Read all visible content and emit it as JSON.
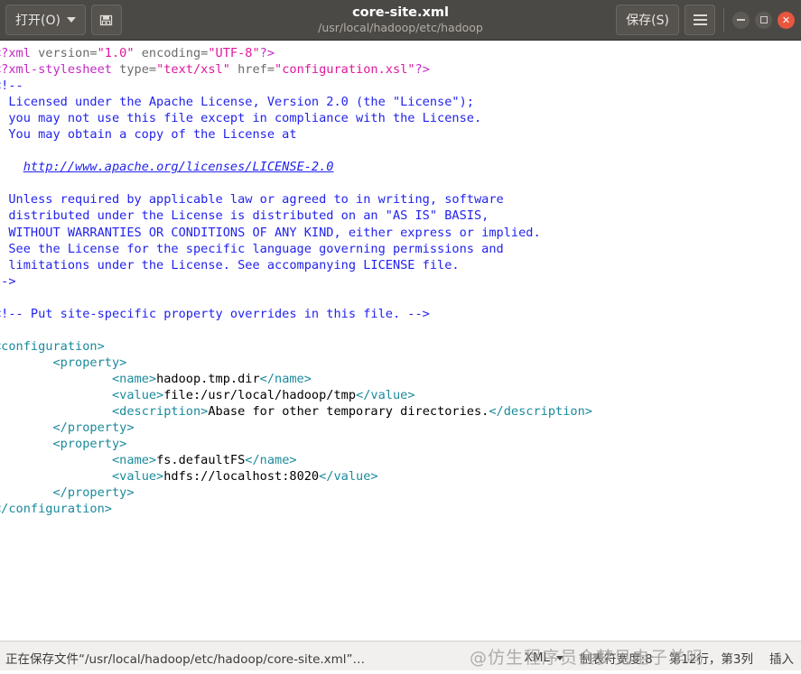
{
  "titlebar": {
    "open_button": "打开(O)",
    "saveas_icon": "save-as-disk-icon",
    "dropdown_icon": "chevron-down-icon",
    "title": "core-site.xml",
    "subtitle": "/usr/local/hadoop/etc/hadoop",
    "save_button": "保存(S)",
    "menu_icon": "hamburger-menu-icon",
    "window_minimize": "−",
    "window_maximize": "□",
    "window_close": "✕",
    "accent_close_color": "#e8563f",
    "bar_color": "#4b4945"
  },
  "editor": {
    "lines": [
      {
        "id": "l1",
        "segments": [
          {
            "cls": "pi",
            "t": "<?xml "
          },
          {
            "cls": "attr",
            "t": "version="
          },
          {
            "cls": "val",
            "t": "\"1.0\""
          },
          {
            "cls": "attr",
            "t": " encoding="
          },
          {
            "cls": "val",
            "t": "\"UTF-8\""
          },
          {
            "cls": "pi",
            "t": "?>"
          }
        ]
      },
      {
        "id": "l2",
        "segments": [
          {
            "cls": "pi",
            "t": "<?xml-stylesheet "
          },
          {
            "cls": "attr",
            "t": "type="
          },
          {
            "cls": "val",
            "t": "\"text/xsl\""
          },
          {
            "cls": "attr",
            "t": " href="
          },
          {
            "cls": "val",
            "t": "\"configuration.xsl\""
          },
          {
            "cls": "pi",
            "t": "?>"
          }
        ]
      },
      {
        "id": "l3",
        "segments": [
          {
            "cls": "cmt",
            "t": "<!--"
          }
        ]
      },
      {
        "id": "l4",
        "segments": [
          {
            "cls": "cmt",
            "t": "  Licensed under the Apache License, Version 2.0 (the \"License\");"
          }
        ]
      },
      {
        "id": "l5",
        "segments": [
          {
            "cls": "cmt",
            "t": "  you may not use this file except in compliance with the License."
          }
        ]
      },
      {
        "id": "l6",
        "segments": [
          {
            "cls": "cmt",
            "t": "  You may obtain a copy of the License at"
          }
        ]
      },
      {
        "id": "l7",
        "segments": [
          {
            "cls": "cmt",
            "t": ""
          }
        ]
      },
      {
        "id": "l8",
        "segments": [
          {
            "cls": "cmt",
            "t": "    "
          },
          {
            "cls": "lnk",
            "t": "http://www.apache.org/licenses/LICENSE-2.0"
          }
        ]
      },
      {
        "id": "l9",
        "segments": [
          {
            "cls": "cmt",
            "t": ""
          }
        ]
      },
      {
        "id": "l10",
        "segments": [
          {
            "cls": "cmt",
            "t": "  Unless required by applicable law or agreed to in writing, software"
          }
        ]
      },
      {
        "id": "l11",
        "segments": [
          {
            "cls": "cmt",
            "t": "  distributed under the License is distributed on an \"AS IS\" BASIS,"
          }
        ]
      },
      {
        "id": "l12",
        "segments": [
          {
            "cls": "cmt",
            "t": "  WITHOUT WARRANTIES OR CONDITIONS OF ANY KIND, either express or implied."
          }
        ]
      },
      {
        "id": "l13",
        "segments": [
          {
            "cls": "cmt",
            "t": "  See the License for the specific language governing permissions and"
          }
        ]
      },
      {
        "id": "l14",
        "segments": [
          {
            "cls": "cmt",
            "t": "  limitations under the License. See accompanying LICENSE file."
          }
        ]
      },
      {
        "id": "l15",
        "segments": [
          {
            "cls": "cmt",
            "t": "-->"
          }
        ]
      },
      {
        "id": "l16",
        "segments": [
          {
            "cls": "txt",
            "t": ""
          }
        ]
      },
      {
        "id": "l17",
        "segments": [
          {
            "cls": "cmt",
            "t": "<!-- Put site-specific property overrides in this file. -->"
          }
        ]
      },
      {
        "id": "l18",
        "segments": [
          {
            "cls": "txt",
            "t": ""
          }
        ]
      },
      {
        "id": "l19",
        "segments": [
          {
            "cls": "tag",
            "t": "<configuration>"
          }
        ]
      },
      {
        "id": "l20",
        "segments": [
          {
            "cls": "txt",
            "t": "        "
          },
          {
            "cls": "tag",
            "t": "<property>"
          }
        ]
      },
      {
        "id": "l21",
        "segments": [
          {
            "cls": "txt",
            "t": "                "
          },
          {
            "cls": "tag",
            "t": "<name>"
          },
          {
            "cls": "txt",
            "t": "hadoop.tmp.dir"
          },
          {
            "cls": "tag",
            "t": "</name>"
          }
        ]
      },
      {
        "id": "l22",
        "segments": [
          {
            "cls": "txt",
            "t": "                "
          },
          {
            "cls": "tag",
            "t": "<value>"
          },
          {
            "cls": "txt",
            "t": "file:/usr/local/hadoop/tmp"
          },
          {
            "cls": "tag",
            "t": "</value>"
          }
        ]
      },
      {
        "id": "l23",
        "segments": [
          {
            "cls": "txt",
            "t": "                "
          },
          {
            "cls": "tag",
            "t": "<description>"
          },
          {
            "cls": "txt",
            "t": "Abase for other temporary directories."
          },
          {
            "cls": "tag",
            "t": "</description>"
          }
        ]
      },
      {
        "id": "l24",
        "segments": [
          {
            "cls": "txt",
            "t": "        "
          },
          {
            "cls": "tag",
            "t": "</property>"
          }
        ]
      },
      {
        "id": "l25",
        "segments": [
          {
            "cls": "txt",
            "t": "        "
          },
          {
            "cls": "tag",
            "t": "<property>"
          }
        ]
      },
      {
        "id": "l26",
        "segments": [
          {
            "cls": "txt",
            "t": "                "
          },
          {
            "cls": "tag",
            "t": "<name>"
          },
          {
            "cls": "txt",
            "t": "fs.defaultFS"
          },
          {
            "cls": "tag",
            "t": "</name>"
          }
        ]
      },
      {
        "id": "l27",
        "segments": [
          {
            "cls": "txt",
            "t": "                "
          },
          {
            "cls": "tag",
            "t": "<value>"
          },
          {
            "cls": "txt",
            "t": "hdfs://localhost:8020"
          },
          {
            "cls": "tag",
            "t": "</value>"
          }
        ]
      },
      {
        "id": "l28",
        "segments": [
          {
            "cls": "txt",
            "t": "        "
          },
          {
            "cls": "tag",
            "t": "</property>"
          }
        ]
      },
      {
        "id": "l29",
        "segments": [
          {
            "cls": "tag",
            "t": "</configuration>"
          }
        ]
      }
    ],
    "colors": {
      "tag": "#1a8a9c",
      "processing_instruction": "#c628c6",
      "attribute_value": "#e0179b",
      "comment": "#2222ee",
      "text": "#000000",
      "background": "#ffffff"
    }
  },
  "statusbar": {
    "message": "正在保存文件“/usr/local/hadoop/etc/hadoop/core-site.xml”…",
    "language": "XML",
    "language_caret_icon": "chevron-down-icon",
    "tab_width": "制表符宽度:8",
    "cursor_position": "第12行，第3列",
    "insert_mode": "插入"
  },
  "watermark": {
    "text": "@仿生程序员会梦见电子羊吗"
  }
}
